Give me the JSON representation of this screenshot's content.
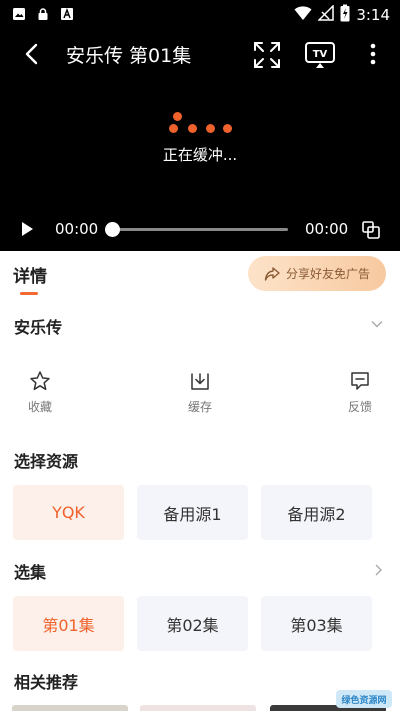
{
  "status_bar": {
    "time": "3:14",
    "left_icons": [
      "image-icon",
      "lock-icon",
      "font-icon"
    ],
    "right_icons": [
      "wifi-icon",
      "signal-icon",
      "battery-icon"
    ]
  },
  "player": {
    "title": "安乐传 第01集",
    "loading_text": "正在缓冲...",
    "current_time": "00:00",
    "total_time": "00:00",
    "progress": 0,
    "accent": "#f0622c"
  },
  "tabs": {
    "detail_label": "详情",
    "accent": "#f26a32"
  },
  "share": {
    "label": "分享好友免广告"
  },
  "show": {
    "title": "安乐传"
  },
  "actions": [
    {
      "icon": "star-icon",
      "label": "收藏"
    },
    {
      "icon": "download-icon",
      "label": "缓存"
    },
    {
      "icon": "feedback-icon",
      "label": "反馈"
    }
  ],
  "sources": {
    "title": "选择资源",
    "items": [
      "YQK",
      "备用源1",
      "备用源2"
    ],
    "selected_index": 0
  },
  "episodes": {
    "title": "选集",
    "items": [
      "第01集",
      "第02集",
      "第03集"
    ],
    "selected_index": 0
  },
  "recommend": {
    "title": "相关推荐"
  },
  "watermark": {
    "text": "绿色资源网"
  }
}
